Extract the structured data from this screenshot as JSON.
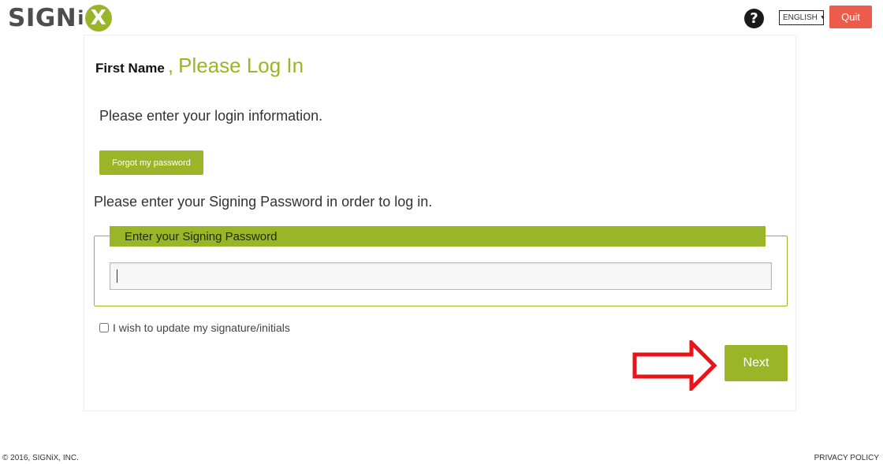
{
  "header": {
    "logo_main": "SIGN",
    "logo_i": "i",
    "logo_x": "X",
    "help_symbol": "?",
    "language": "ENGLISH",
    "quit_label": "Quit"
  },
  "login": {
    "first_name": "First Name",
    "separator": ",",
    "title": "Please Log In",
    "intro": "Please enter your login information.",
    "forgot_label": "Forgot my password",
    "instruction": "Please enter your Signing Password in order to log in.",
    "password_legend": "Enter your Signing Password",
    "password_value": "",
    "update_signature_label": "I wish to update my signature/initials",
    "update_signature_checked": false,
    "next_label": "Next"
  },
  "footer": {
    "copyright": "© 2016, SIGNiX, INC.",
    "privacy": "PRIVACY POLICY"
  },
  "colors": {
    "brand_green": "#9bb528",
    "quit_red": "#ec5b4b",
    "annotation_red": "#e8141a"
  },
  "icons": {
    "help": "question-circle-icon",
    "language_caret": "caret-down-icon",
    "annotation": "right-arrow-outline-icon"
  }
}
